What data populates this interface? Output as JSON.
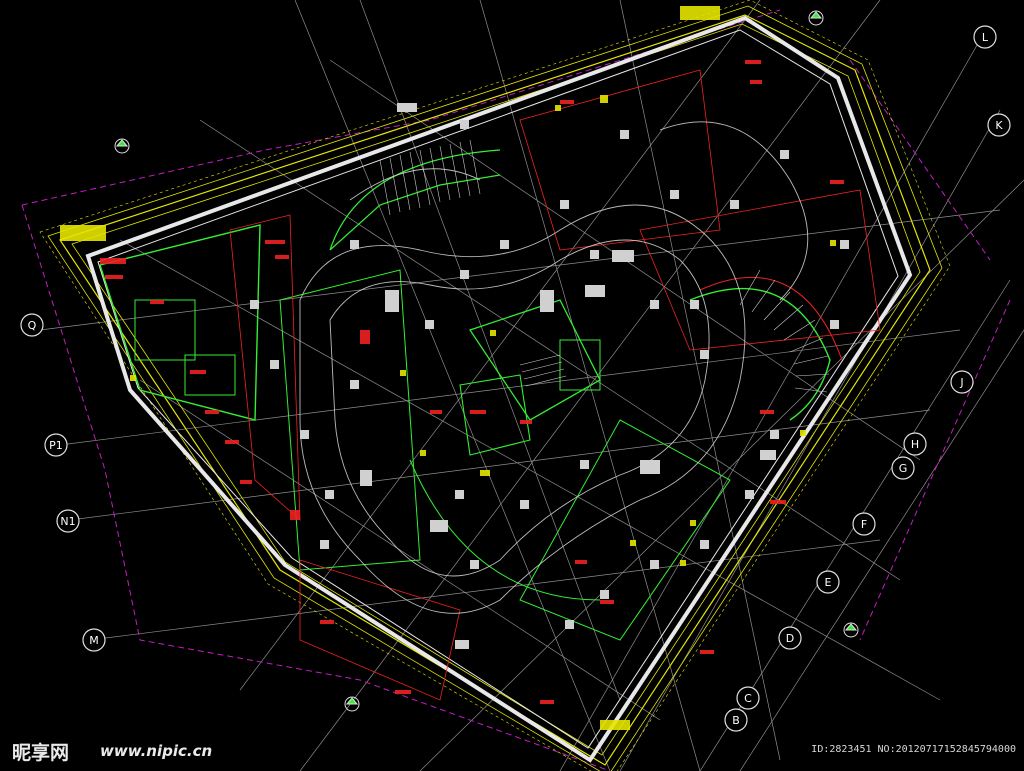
{
  "colors": {
    "background": "#000000",
    "wall": "#e6e6e6",
    "site_boundary": "#e6e600",
    "axis_line": "#c8c8c8",
    "dim_line": "#c020c0",
    "core_green": "#33ee33",
    "annotation_red": "#ee2222"
  },
  "grid_bubbles": {
    "left": [
      "Q",
      "P1",
      "N1",
      "M"
    ],
    "right_lower": [
      "B",
      "C",
      "D",
      "E",
      "F",
      "G",
      "H",
      "J"
    ],
    "right_upper": [
      "K",
      "L"
    ]
  },
  "watermark": {
    "logo": "昵享网",
    "url": "www.nipic.cn",
    "id_line": "ID:2823451 NO:20120717152845794000"
  }
}
